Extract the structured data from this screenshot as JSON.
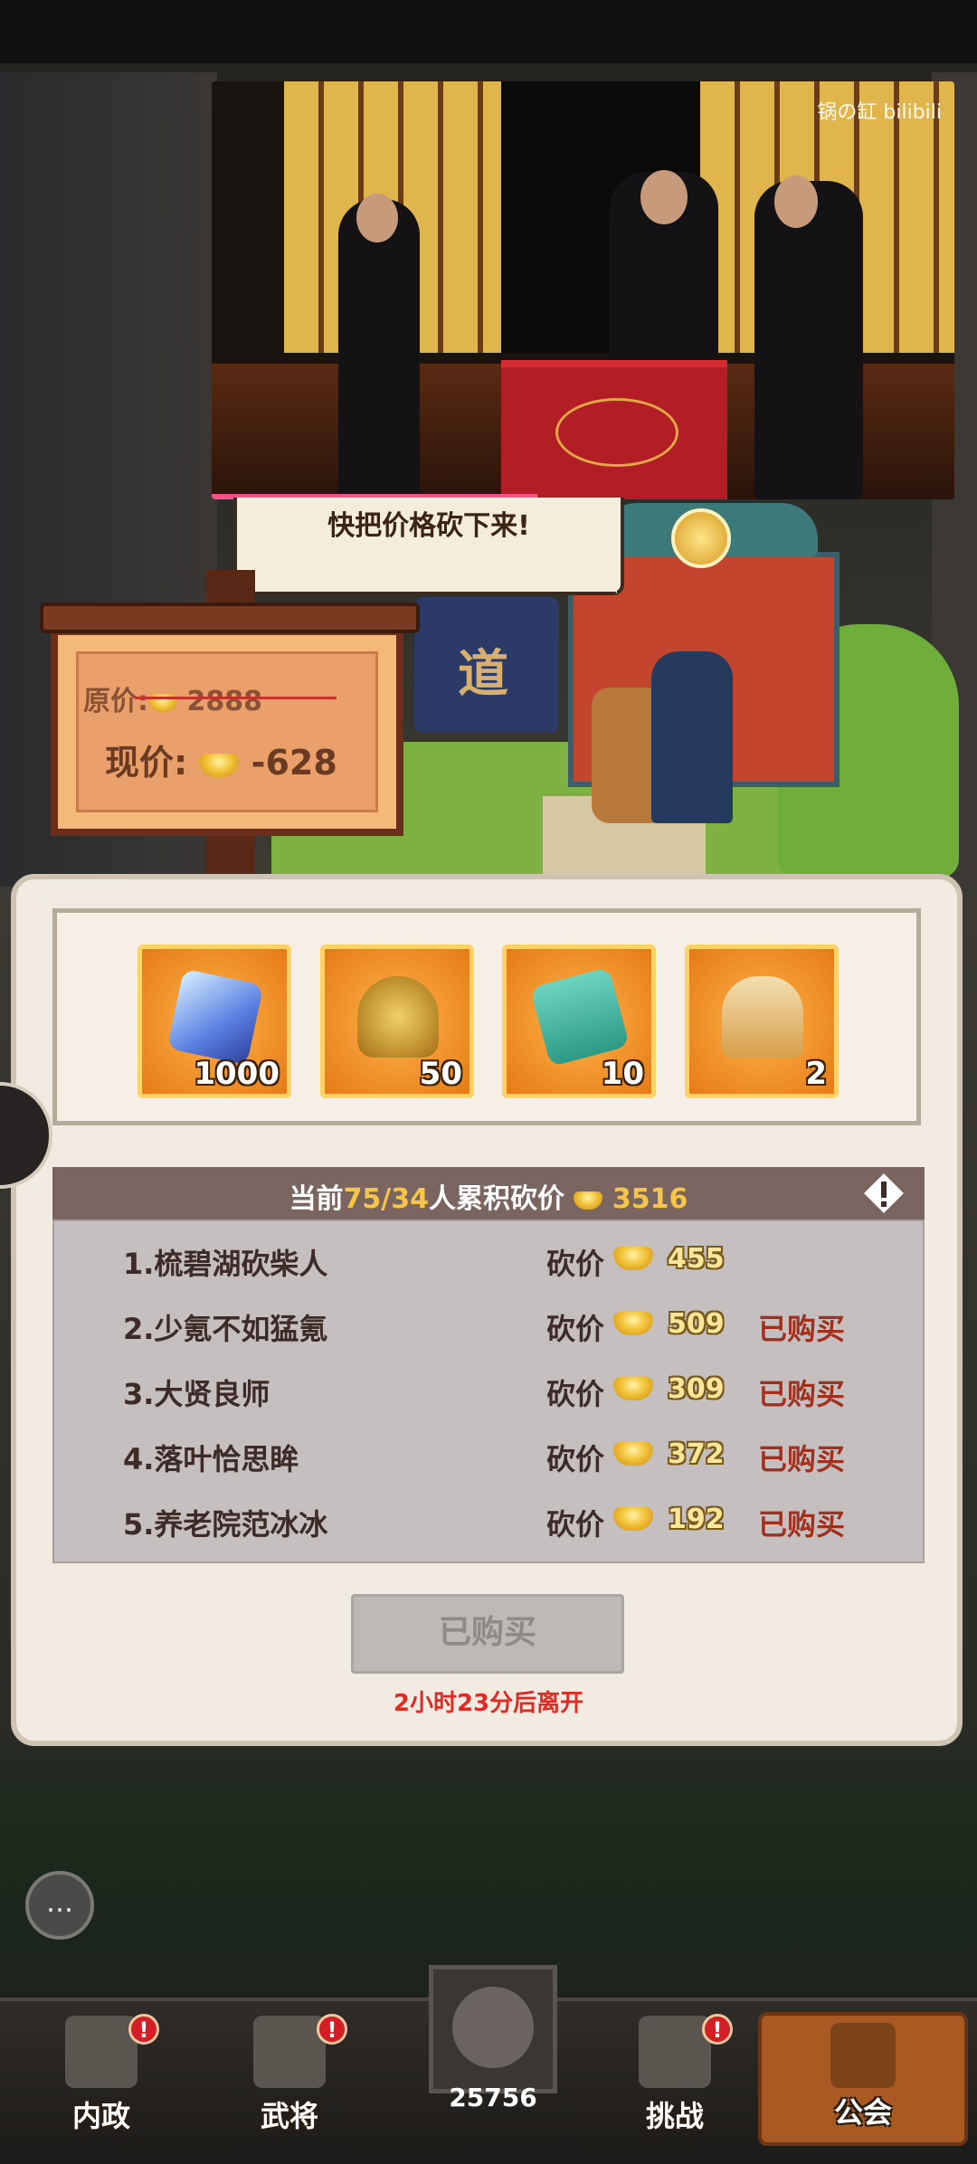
{
  "video": {
    "watermark": "锅の缸 bilibili"
  },
  "bubble": {
    "text": "快把价格砍下来!"
  },
  "price_board": {
    "original_label": "原价:",
    "original_price": "2888",
    "current_label": "现价:",
    "current_price": "-628"
  },
  "scene": {
    "banner_char": "道"
  },
  "rewards": [
    {
      "name": "crystal",
      "qty": "1000"
    },
    {
      "name": "golden-bell",
      "qty": "50"
    },
    {
      "name": "jade-scroll",
      "qty": "10"
    },
    {
      "name": "charm-token",
      "qty": "2"
    }
  ],
  "bargain": {
    "header_prefix": "当前",
    "header_count": "75/34",
    "header_suffix": "人累积砍价",
    "header_total": "3516",
    "rows": [
      {
        "name": "1.梳碧湖砍柴人",
        "cut_label": "砍价",
        "amount": "455",
        "status": ""
      },
      {
        "name": "2.少氪不如猛氪",
        "cut_label": "砍价",
        "amount": "509",
        "status": "已购买"
      },
      {
        "name": "3.大贤良师",
        "cut_label": "砍价",
        "amount": "309",
        "status": "已购买"
      },
      {
        "name": "4.落叶恰思眸",
        "cut_label": "砍价",
        "amount": "372",
        "status": "已购买"
      },
      {
        "name": "5.养老院范冰冰",
        "cut_label": "砍价",
        "amount": "192",
        "status": "已购买"
      }
    ]
  },
  "buy_button": {
    "label": "已购买"
  },
  "timer": {
    "text": "2小时23分后离开"
  },
  "chat": {
    "icon": "chat-bubble-icon"
  },
  "nav": {
    "items": [
      {
        "label": "内政",
        "badge": "!"
      },
      {
        "label": "武将",
        "badge": "!"
      },
      {
        "label": "挑战",
        "badge": "!"
      },
      {
        "label": "公会",
        "badge": ""
      }
    ],
    "boss_count": "25756"
  }
}
